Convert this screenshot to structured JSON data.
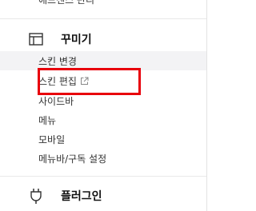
{
  "previous_section": {
    "last_item_label": "애드센스 관리"
  },
  "decorate_section": {
    "icon": "layout-icon",
    "title": "꾸미기",
    "items": [
      {
        "label": "스킨 변경"
      },
      {
        "label": "스킨 편집",
        "icon": "external-link-icon"
      },
      {
        "label": "사이드바"
      },
      {
        "label": "메뉴"
      },
      {
        "label": "모바일"
      },
      {
        "label": "메뉴바/구독 설정"
      }
    ]
  },
  "plugin_section": {
    "icon": "plug-icon",
    "title": "플러그인"
  },
  "annotation": {
    "color": "#e8000b"
  }
}
